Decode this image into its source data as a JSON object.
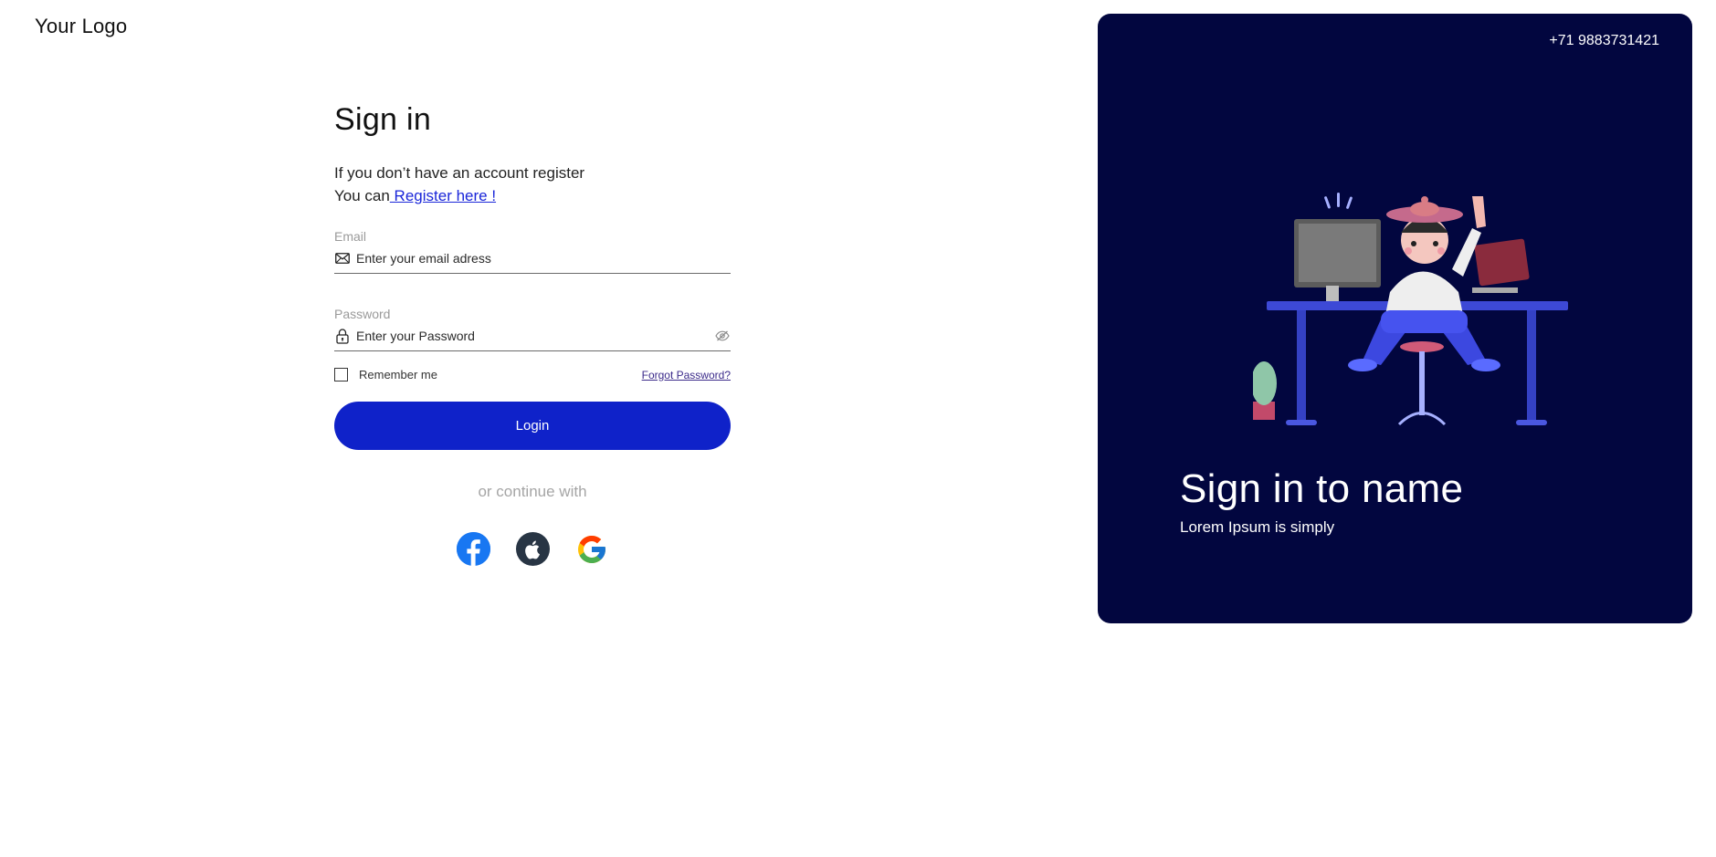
{
  "logo": {
    "text": "Your Logo"
  },
  "form": {
    "title": "Sign in",
    "intro_line1": "If you don’t have an account register",
    "intro_line2_prefix": "You can",
    "register_link": " Register here !",
    "email": {
      "label": "Email",
      "placeholder": "Enter your email adress",
      "value": ""
    },
    "password": {
      "label": "Password",
      "placeholder": "Enter your Password",
      "value": ""
    },
    "remember_label": "Remember me",
    "remember_checked": false,
    "forgot_label": "Forgot Password?",
    "login_label": "Login",
    "continue_text": "or continue with",
    "socials": [
      {
        "icon": "facebook-icon",
        "color": "#1877f2"
      },
      {
        "icon": "apple-icon",
        "color": "#283544"
      },
      {
        "icon": "google-icon",
        "color": "#ffffff"
      }
    ]
  },
  "panel": {
    "phone": "+71 9883731421",
    "title": "Sign in to name",
    "subtitle": "Lorem Ipsum is simply",
    "background": "#02063f"
  },
  "colors": {
    "primary": "#0f22c9",
    "link": "#1a26d9"
  }
}
